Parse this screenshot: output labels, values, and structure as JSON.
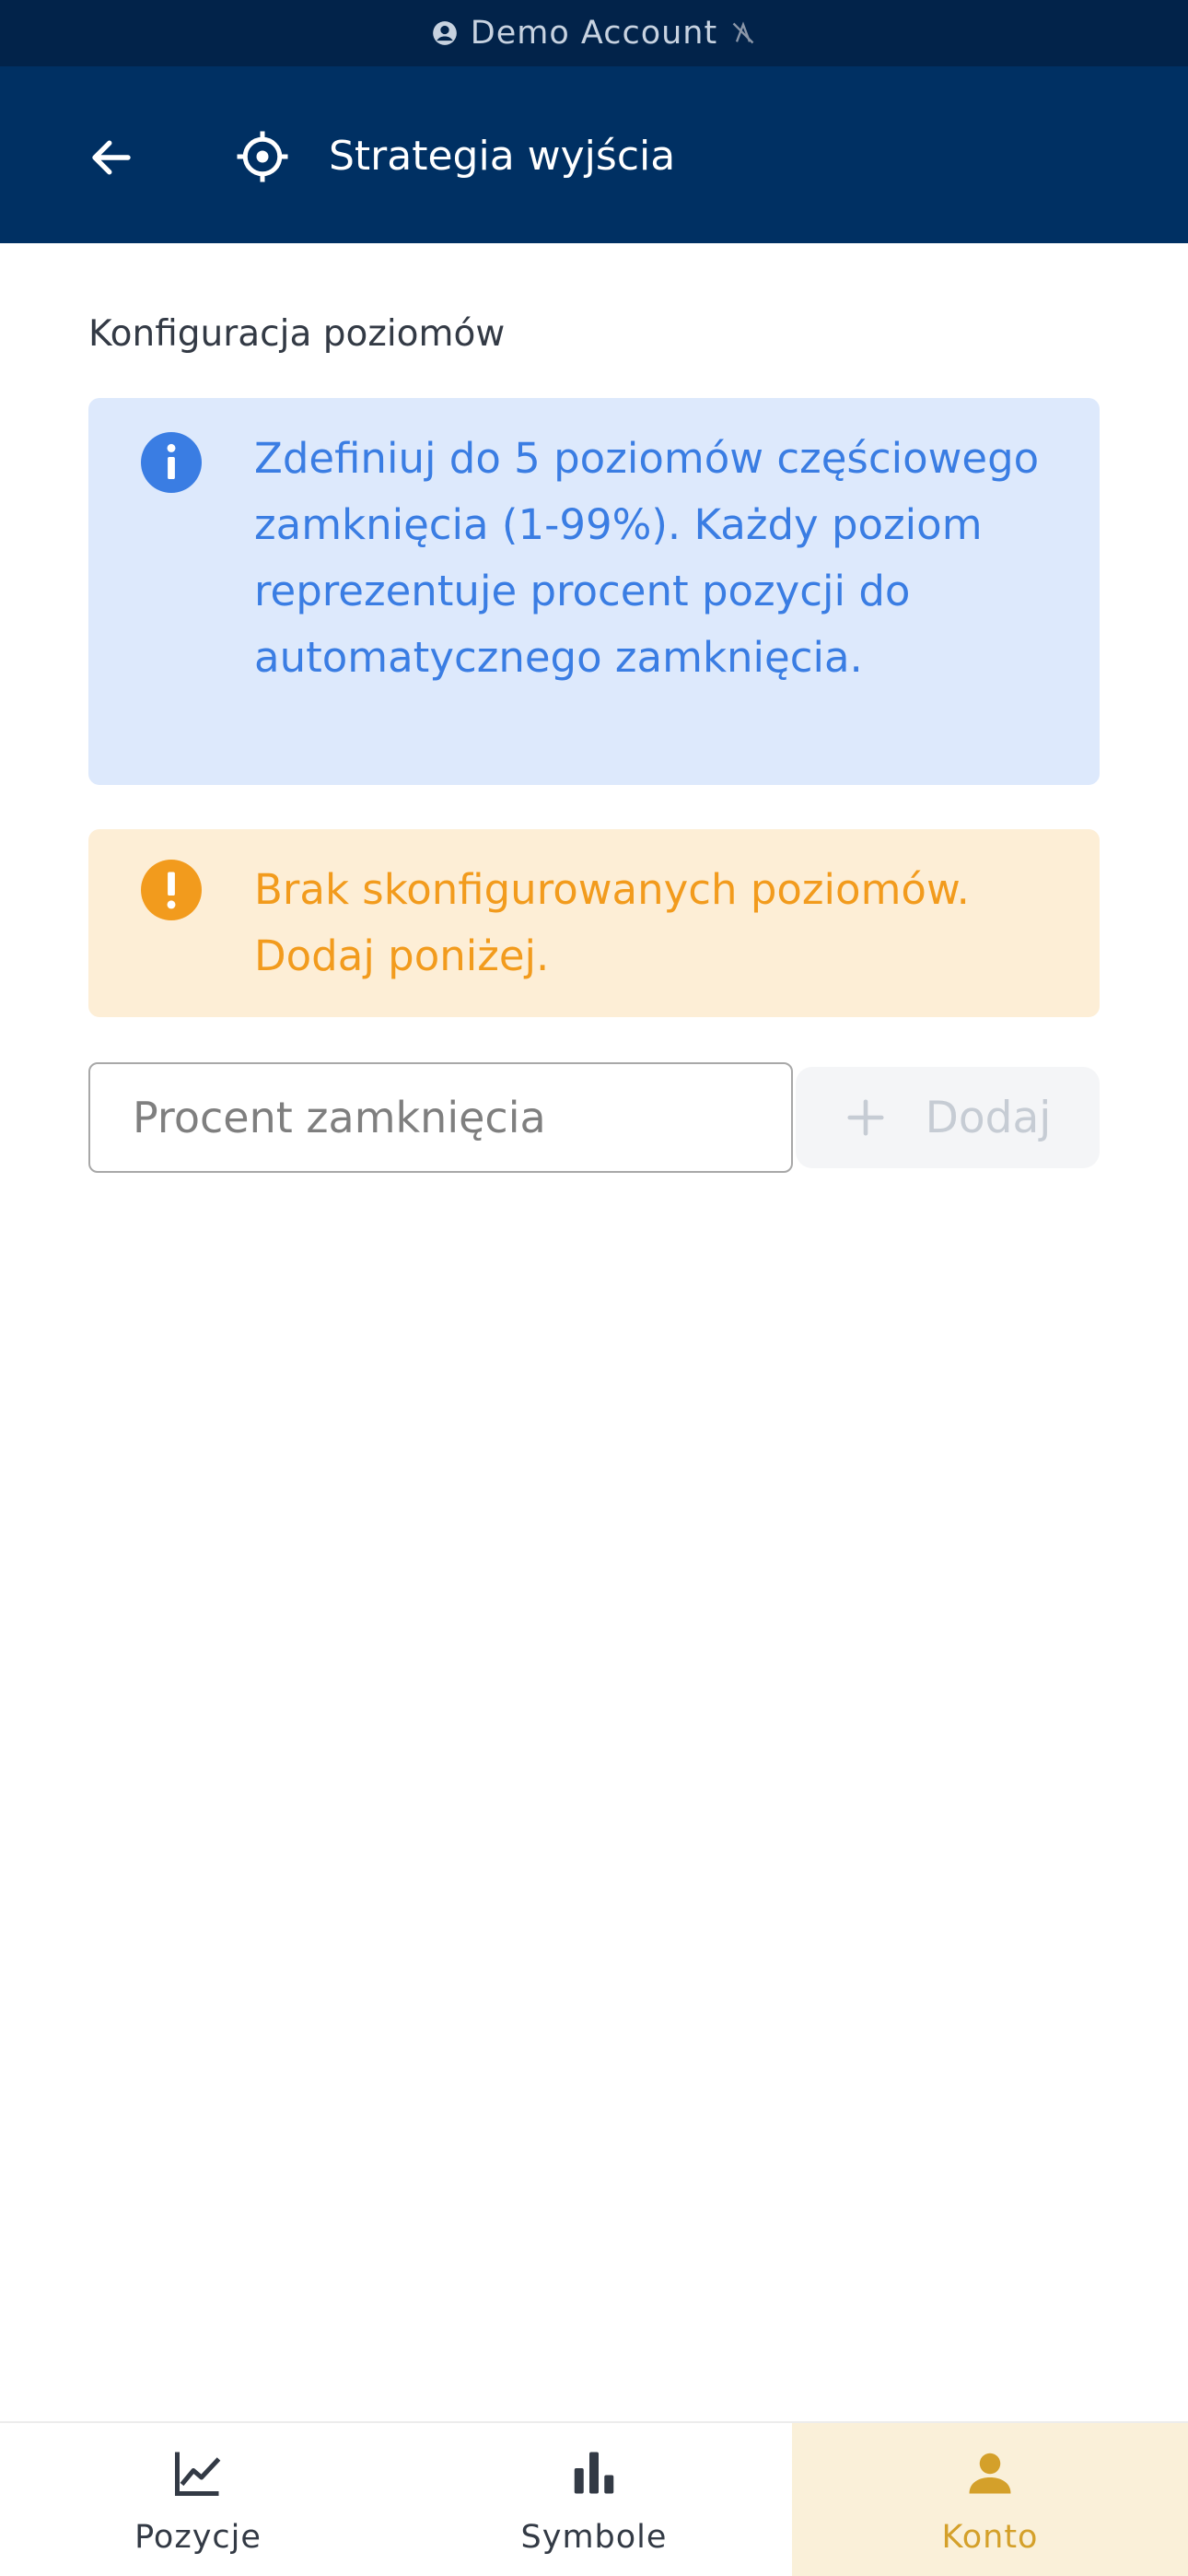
{
  "status_bar": {
    "label": "Demo Account",
    "account_icon": "account-circle-icon",
    "signal_icon": "signal-off-icon"
  },
  "header": {
    "back_icon": "arrow-back-icon",
    "title_icon": "crosshair-target-icon",
    "title": "Strategia wyjścia"
  },
  "section": {
    "title": "Konfiguracja poziomów"
  },
  "info_box": {
    "icon": "info-icon",
    "text": "Zdefiniuj do 5 poziomów częściowego zamknięcia (1-99%). Każdy poziom reprezentuje procent pozycji do automatycznego zamknięcia."
  },
  "warning_box": {
    "icon": "warning-icon",
    "text": "Brak skonfigurowanych poziomów. Dodaj poniżej."
  },
  "form": {
    "input_value": "",
    "input_placeholder": "Procent zamknięcia",
    "add_label": "Dodaj",
    "add_icon": "plus-icon"
  },
  "bottom_nav": {
    "items": [
      {
        "label": "Pozycje",
        "icon": "line-chart-icon",
        "active": false
      },
      {
        "label": "Symbole",
        "icon": "bar-chart-icon",
        "active": false
      },
      {
        "label": "Konto",
        "icon": "person-icon",
        "active": true
      }
    ]
  },
  "colors": {
    "status_bar_bg": "#02234a",
    "header_bg": "#003063",
    "info_bg": "#dde9fc",
    "info_accent": "#3a7de3",
    "warning_bg": "#fdeed6",
    "warning_accent": "#f29b1d",
    "active_nav_bg": "#faf0d9",
    "active_nav_text": "#d4a02a"
  }
}
